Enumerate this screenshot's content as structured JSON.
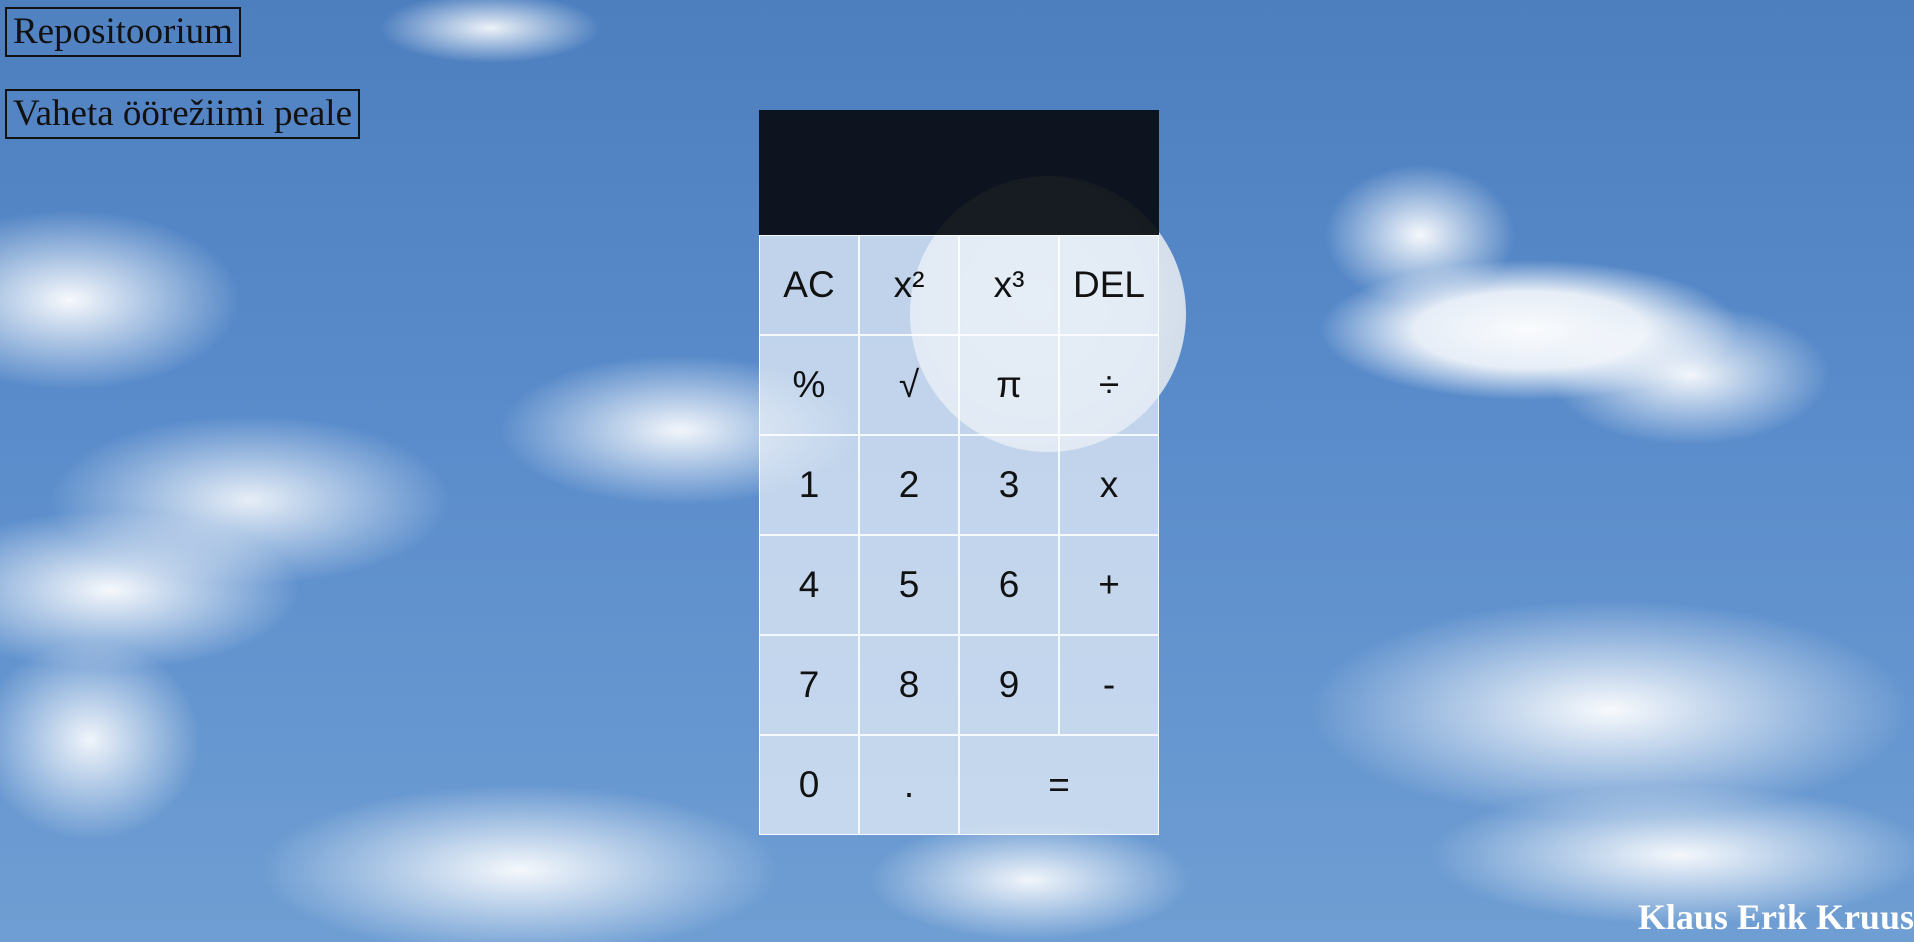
{
  "nav": {
    "repository_label": "Repositoorium",
    "mode_toggle_label": "Vaheta öörežiimi peale"
  },
  "calculator": {
    "display_value": "",
    "keys": [
      {
        "label": "AC"
      },
      {
        "label": "x²"
      },
      {
        "label": "x³"
      },
      {
        "label": "DEL"
      },
      {
        "label": "%"
      },
      {
        "label": "√"
      },
      {
        "label": "π"
      },
      {
        "label": "÷"
      },
      {
        "label": "1"
      },
      {
        "label": "2"
      },
      {
        "label": "3"
      },
      {
        "label": "x"
      },
      {
        "label": "4"
      },
      {
        "label": "5"
      },
      {
        "label": "6"
      },
      {
        "label": "+"
      },
      {
        "label": "7"
      },
      {
        "label": "8"
      },
      {
        "label": "9"
      },
      {
        "label": "-"
      },
      {
        "label": "0"
      },
      {
        "label": "."
      },
      {
        "label": "="
      }
    ]
  },
  "footer": {
    "author": "Klaus Erik Kruus"
  },
  "colors": {
    "sky": "#5a8ccb",
    "display_background": "#0b1118",
    "key_background": "#e6eef7"
  }
}
